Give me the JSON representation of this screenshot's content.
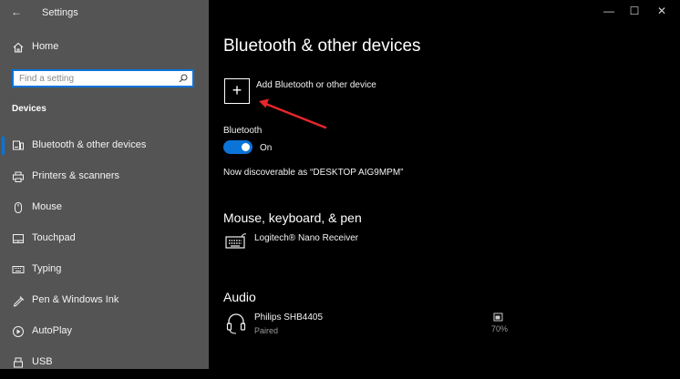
{
  "window": {
    "title": "Settings",
    "back_glyph": "←",
    "minimize_glyph": "—",
    "maximize_glyph": "☐",
    "close_glyph": "✕"
  },
  "sidebar": {
    "home_label": "Home",
    "search_placeholder": "Find a setting",
    "section_title": "Devices",
    "items": [
      {
        "label": "Bluetooth & other devices",
        "icon": "bluetooth-devices-icon",
        "active": true
      },
      {
        "label": "Printers & scanners",
        "icon": "printer-icon"
      },
      {
        "label": "Mouse",
        "icon": "mouse-icon"
      },
      {
        "label": "Touchpad",
        "icon": "touchpad-icon"
      },
      {
        "label": "Typing",
        "icon": "keyboard-icon"
      },
      {
        "label": "Pen & Windows Ink",
        "icon": "pen-icon"
      },
      {
        "label": "AutoPlay",
        "icon": "autoplay-icon"
      },
      {
        "label": "USB",
        "icon": "usb-icon"
      }
    ]
  },
  "main": {
    "page_title": "Bluetooth & other devices",
    "add_device_label": "Add Bluetooth or other device",
    "add_glyph": "+",
    "bluetooth_label": "Bluetooth",
    "toggle_state": "On",
    "discoverable_text": "Now discoverable as “DESKTOP AIG9MPM”",
    "mouse_section_title": "Mouse, keyboard, & pen",
    "mouse_devices": [
      {
        "name": "Logitech® Nano Receiver",
        "icon": "keyboard-icon"
      }
    ],
    "audio_section_title": "Audio",
    "audio_devices": [
      {
        "name": "Philips SHB4405",
        "status": "Paired",
        "battery": "70%",
        "icon": "headset-icon"
      }
    ]
  },
  "colors": {
    "accent": "#0a74d8",
    "annotation_arrow": "#e8272b",
    "sidebar_bg": "#545454",
    "main_bg": "#000000"
  }
}
